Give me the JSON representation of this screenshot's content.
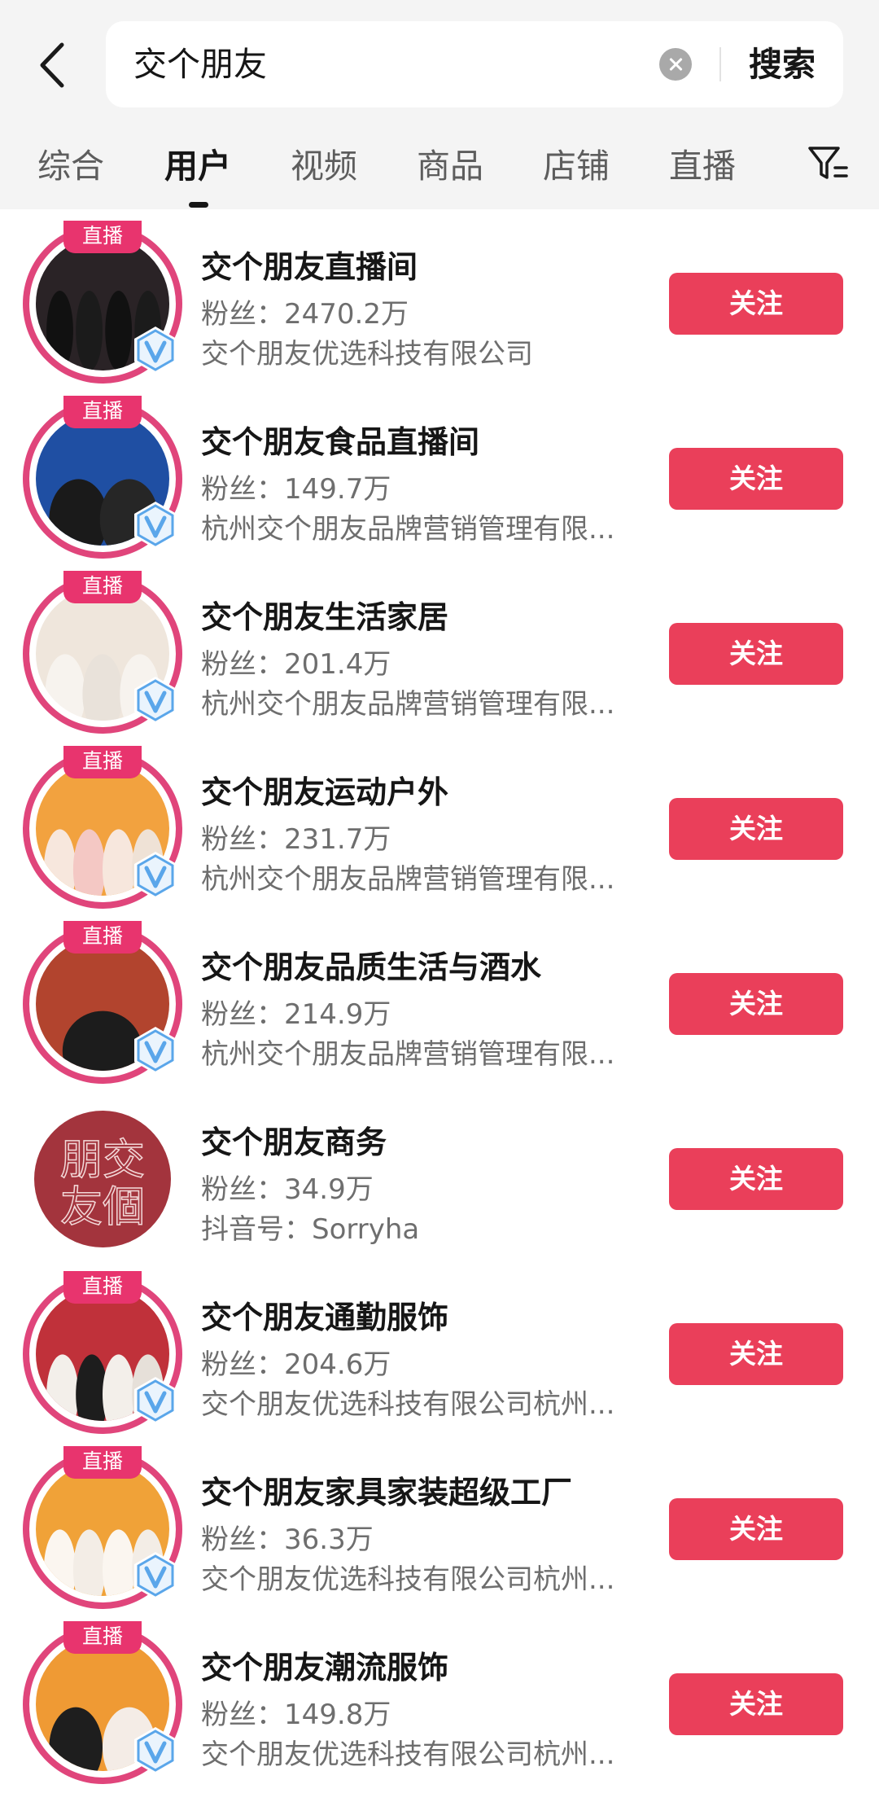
{
  "search": {
    "query": "交个朋友",
    "button_label": "搜索"
  },
  "tabs": [
    {
      "label": "综合",
      "active": false
    },
    {
      "label": "用户",
      "active": true
    },
    {
      "label": "视频",
      "active": false
    },
    {
      "label": "商品",
      "active": false
    },
    {
      "label": "店铺",
      "active": false
    },
    {
      "label": "直播",
      "active": false
    }
  ],
  "results": [
    {
      "name": "交个朋友直播间",
      "fans": "粉丝：2470.2万",
      "desc": "交个朋友优选科技有限公司",
      "live_badge": "直播",
      "follow_label": "关注",
      "avatar_bg": "#2a2326",
      "avatar_accent": "#111111"
    },
    {
      "name": "交个朋友食品直播间",
      "fans": "粉丝：149.7万",
      "desc": "杭州交个朋友品牌营销管理有限...",
      "live_badge": "直播",
      "follow_label": "关注",
      "avatar_bg": "#1f4fa3",
      "avatar_accent": "#1a1a1a"
    },
    {
      "name": "交个朋友生活家居",
      "fans": "粉丝：201.4万",
      "desc": "杭州交个朋友品牌营销管理有限...",
      "live_badge": "直播",
      "follow_label": "关注",
      "avatar_bg": "#efe6dc",
      "avatar_accent": "#f7f3ee"
    },
    {
      "name": "交个朋友运动户外",
      "fans": "粉丝：231.7万",
      "desc": "杭州交个朋友品牌营销管理有限...",
      "live_badge": "直播",
      "follow_label": "关注",
      "avatar_bg": "#f2a23f",
      "avatar_accent": "#f7e7dd"
    },
    {
      "name": "交个朋友品质生活与酒水",
      "fans": "粉丝：214.9万",
      "desc": "杭州交个朋友品牌营销管理有限...",
      "live_badge": "直播",
      "follow_label": "关注",
      "avatar_bg": "#b2442e",
      "avatar_accent": "#1c1c1c"
    },
    {
      "name": "交个朋友商务",
      "fans": "粉丝：34.9万",
      "desc": "抖音号：Sorryha",
      "live_badge": "",
      "follow_label": "关注",
      "avatar_bg": "#a3343d",
      "avatar_accent": "#a3343d",
      "logo_text": "朋交 友個"
    },
    {
      "name": "交个朋友通勤服饰",
      "fans": "粉丝：204.6万",
      "desc": "交个朋友优选科技有限公司杭州...",
      "live_badge": "直播",
      "follow_label": "关注",
      "avatar_bg": "#c0313a",
      "avatar_accent": "#f3efea"
    },
    {
      "name": "交个朋友家具家装超级工厂",
      "fans": "粉丝：36.3万",
      "desc": "交个朋友优选科技有限公司杭州...",
      "live_badge": "直播",
      "follow_label": "关注",
      "avatar_bg": "#f0a238",
      "avatar_accent": "#fbf6f0"
    },
    {
      "name": "交个朋友潮流服饰",
      "fans": "粉丝：149.8万",
      "desc": "交个朋友优选科技有限公司杭州...",
      "live_badge": "直播",
      "follow_label": "关注",
      "avatar_bg": "#ef9a34",
      "avatar_accent": "#f4ece6"
    }
  ],
  "colors": {
    "follow": "#ea3f5a",
    "live_badge": "#e8346e",
    "verify": "#5aa6ea",
    "background": "#f4f4f4"
  },
  "icons": {
    "back": "chevron-left-icon",
    "clear": "clear-circle-icon",
    "filter": "filter-icon",
    "verify": "verified-v-icon"
  }
}
